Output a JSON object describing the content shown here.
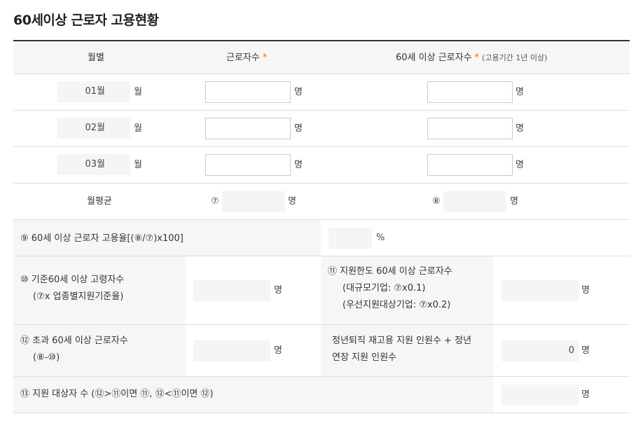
{
  "title": "60세이상 근로자 고용현황",
  "header": {
    "month_col": "월별",
    "workers_col": "근로자수",
    "workers_star": "*",
    "senior_col": "60세 이상 근로자수",
    "senior_star": "*",
    "senior_note": "(고용기간 1년 이상)"
  },
  "months": [
    {
      "label": "01월",
      "suffix": "월",
      "workers": "",
      "senior": "",
      "unit": "명"
    },
    {
      "label": "02월",
      "suffix": "월",
      "workers": "",
      "senior": "",
      "unit": "명"
    },
    {
      "label": "03월",
      "suffix": "월",
      "workers": "",
      "senior": "",
      "unit": "명"
    }
  ],
  "average": {
    "label": "월평균",
    "sym7": "⑦",
    "sym8": "⑧",
    "unit": "명"
  },
  "row9": {
    "label": "⑨ 60세 이상 근로자 고용율[(⑧/⑦)x100]",
    "unit": "%"
  },
  "row10": {
    "label_line1": "⑩  기준60세 이상 고령자수",
    "label_line2": "(⑦x 업종별지원기준율)",
    "unit_left": "명",
    "right_line1": "⑪  지원한도 60세 이상 근로자수",
    "right_line2": "(대규모기업: ⑦x0.1)",
    "right_line3": "(우선지원대상기업: ⑦x0.2)",
    "unit_right": "명"
  },
  "row12": {
    "label_line1": "⑫  초과 60세 이상 근로자수",
    "label_line2": "(⑧-⑩)",
    "unit_left": "명",
    "right_line1": "정년퇴직 재고용 지원 인원수 + 정년",
    "right_line2": "연장 지원 인원수",
    "right_value": "0",
    "unit_right": "명"
  },
  "row13": {
    "label": "⑬  지원 대상자 수 (⑫>⑪이면 ⑪, ⑫<⑪이면 ⑫)",
    "unit": "명"
  }
}
